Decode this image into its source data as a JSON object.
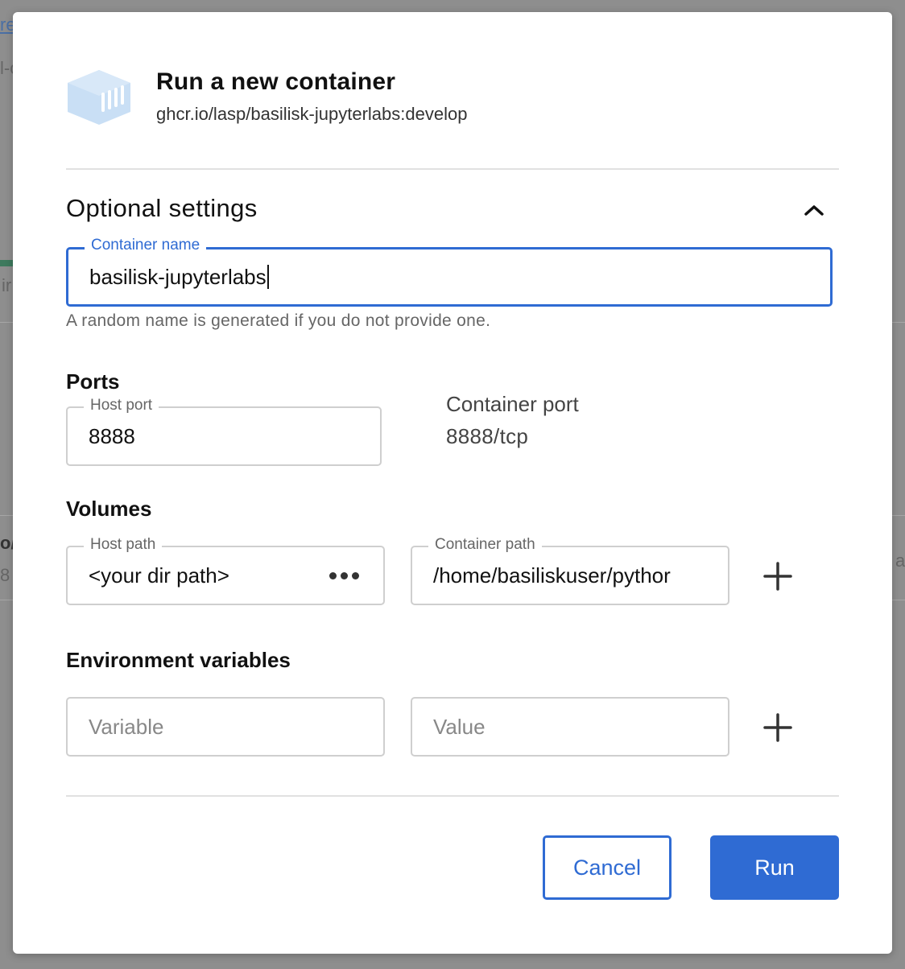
{
  "background": {
    "fragments": [
      "re",
      "l-c",
      "ir",
      "o/",
      "8",
      "a"
    ]
  },
  "dialog": {
    "title": "Run a new container",
    "image_name": "ghcr.io/lasp/basilisk-jupyterlabs:develop",
    "icon": "container-image-icon"
  },
  "optional_settings": {
    "title": "Optional settings",
    "expanded": true,
    "toggle_icon": "chevron-up-icon"
  },
  "container_name": {
    "label": "Container name",
    "value": "basilisk-jupyterlabs",
    "helper": "A random name is generated if you do not provide one."
  },
  "ports": {
    "title": "Ports",
    "host_port_label": "Host port",
    "host_port_value": "8888",
    "container_port_label": "Container port",
    "container_port_value": "8888/tcp"
  },
  "volumes": {
    "title": "Volumes",
    "host_path_label": "Host path",
    "host_path_value": "<your dir path>",
    "container_path_label": "Container path",
    "container_path_value": "/home/basiliskuser/pythor",
    "browse_icon": "more-horizontal-icon",
    "add_icon": "plus-icon"
  },
  "env": {
    "title": "Environment variables",
    "variable_placeholder": "Variable",
    "value_placeholder": "Value",
    "add_icon": "plus-icon"
  },
  "actions": {
    "cancel_label": "Cancel",
    "run_label": "Run"
  },
  "colors": {
    "accent": "#2f6bd3",
    "icon_fill": "#c9dff5",
    "border": "#cfcfcf"
  }
}
